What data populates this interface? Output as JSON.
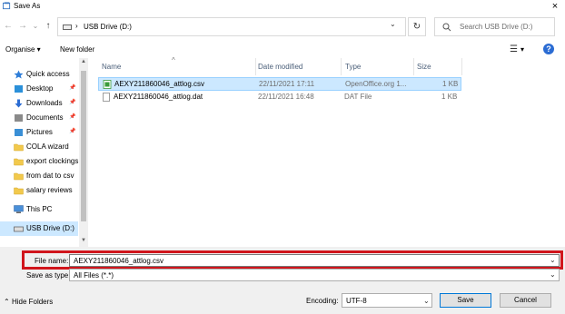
{
  "window": {
    "title": "Save As",
    "close": "×"
  },
  "address": {
    "path_root": "›",
    "location": "USB Drive (D:)"
  },
  "search": {
    "placeholder": "Search USB Drive (D:)"
  },
  "toolbar": {
    "organise": "Organise ▾",
    "new_folder": "New folder",
    "help": "?"
  },
  "nav": {
    "items": [
      {
        "label": "Quick access",
        "icon": "star-icon",
        "pinned": false,
        "color": "#2f7ed8"
      },
      {
        "label": "Desktop",
        "icon": "desktop-icon",
        "pinned": true,
        "color": "#2b90d9"
      },
      {
        "label": "Downloads",
        "icon": "download-icon",
        "pinned": true,
        "color": "#2b6cd3"
      },
      {
        "label": "Documents",
        "icon": "documents-icon",
        "pinned": true,
        "color": "#8a8a8a"
      },
      {
        "label": "Pictures",
        "icon": "pictures-icon",
        "pinned": true,
        "color": "#3a8fd6"
      },
      {
        "label": "COLA wizard",
        "icon": "folder-icon",
        "pinned": false,
        "color": "#f2c94c"
      },
      {
        "label": "export clockings",
        "icon": "folder-icon",
        "pinned": false,
        "color": "#f2c94c"
      },
      {
        "label": "from dat to csv",
        "icon": "folder-icon",
        "pinned": false,
        "color": "#f2c94c"
      },
      {
        "label": "salary reviews",
        "icon": "folder-icon",
        "pinned": false,
        "color": "#f2c94c"
      },
      {
        "label": "This PC",
        "icon": "pc-icon",
        "pinned": false,
        "color": "#4a90d9"
      },
      {
        "label": "USB Drive (D:)",
        "icon": "usb-drive-icon",
        "pinned": false,
        "color": "#555555"
      }
    ]
  },
  "columns": {
    "name": "Name",
    "date": "Date modified",
    "type": "Type",
    "size": "Size"
  },
  "files": [
    {
      "name": "AEXY211860046_attlog.csv",
      "date": "22/11/2021 17:11",
      "type": "OpenOffice.org 1...",
      "size": "1 KB",
      "selected": true,
      "icon": "csv-file-icon"
    },
    {
      "name": "AEXY211860046_attlog.dat",
      "date": "22/11/2021 16:48",
      "type": "DAT File",
      "size": "1 KB",
      "selected": false,
      "icon": "dat-file-icon"
    }
  ],
  "form": {
    "file_name_label": "File name:",
    "file_name_value": "AEXY211860046_attlog.csv",
    "save_type_label": "Save as type:",
    "save_type_value": "All Files  (*.*)",
    "encoding_label": "Encoding:",
    "encoding_value": "UTF-8"
  },
  "buttons": {
    "save": "Save",
    "cancel": "Cancel",
    "hide_folders": "Hide Folders"
  },
  "colors": {
    "highlight": "#d0151c",
    "selection": "#cce8ff",
    "accent": "#0078d7"
  }
}
